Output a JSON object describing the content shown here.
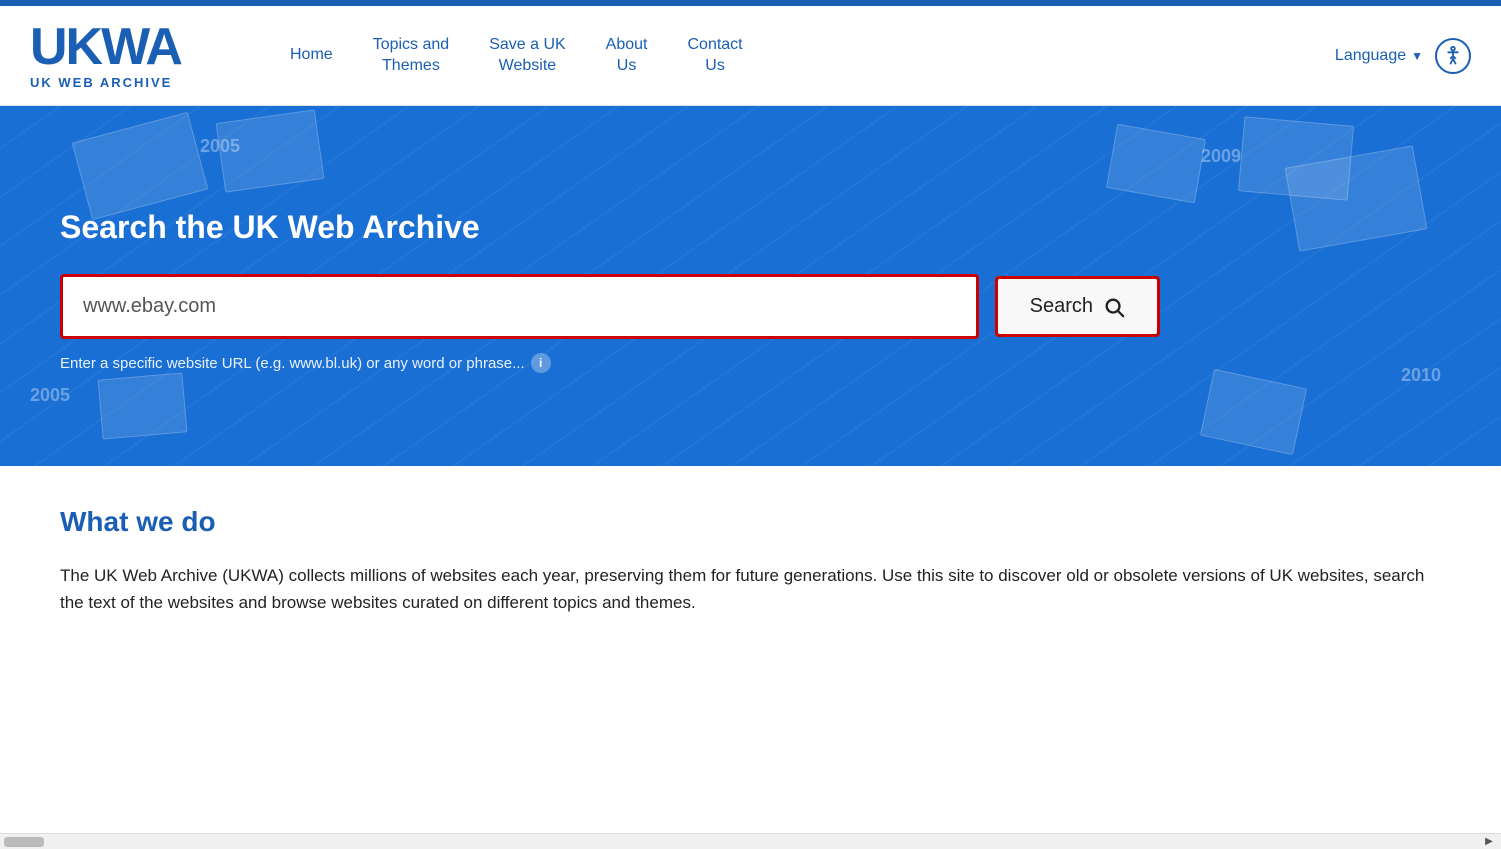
{
  "topBorder": {},
  "header": {
    "logo": {
      "ukwa": "UKWA",
      "subtitle": "UK WEB ARCHIVE"
    },
    "nav": {
      "home": "Home",
      "topics": "Topics and\nThemes",
      "save": "Save a UK\nWebsite",
      "about": "About\nUs",
      "contact": "Contact\nUs",
      "language": "Language"
    }
  },
  "hero": {
    "title": "Search the UK Web Archive",
    "searchValue": "www.ebay.com",
    "searchPlaceholder": "www.ebay.com",
    "searchButtonLabel": "Search",
    "hintText": "Enter a specific website URL (e.g. www.bl.uk) or any word or phrase...",
    "years": [
      "2005",
      "2005",
      "2009",
      "2010"
    ]
  },
  "whatWeDo": {
    "title": "What we do",
    "body": "The UK Web Archive (UKWA) collects millions of websites each year, preserving them for future generations. Use this site to discover old or obsolete versions of UK websites, search the text of the websites and browse websites curated on different topics and themes."
  }
}
